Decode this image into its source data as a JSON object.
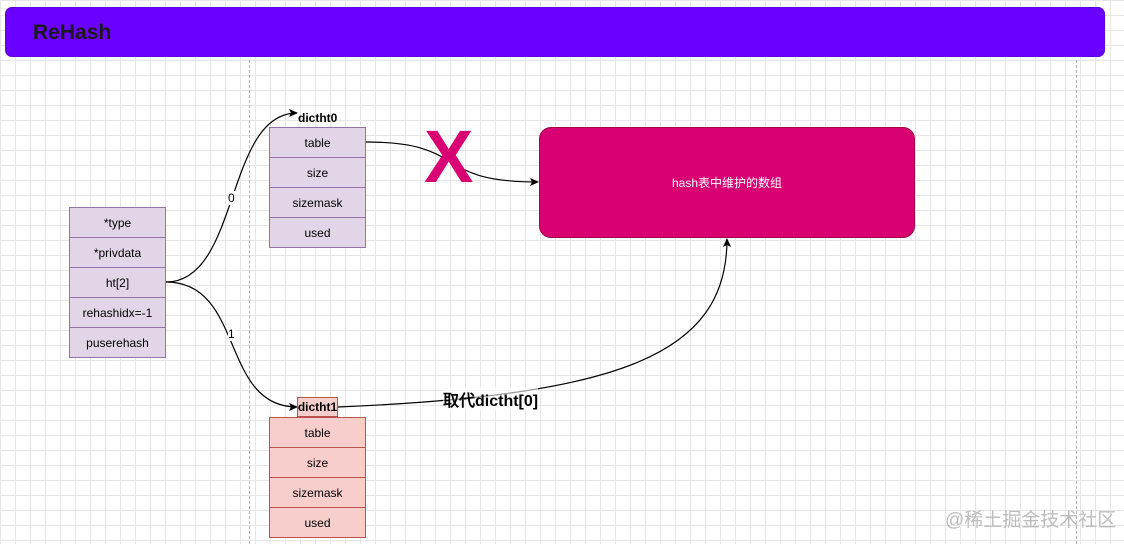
{
  "title": "ReHash",
  "dict": {
    "fields": [
      "*type",
      "*privdata",
      "ht[2]",
      "rehashidx=-1",
      "puserehash"
    ]
  },
  "dictht0": {
    "label": "dictht0",
    "fields": [
      "table",
      "size",
      "sizemask",
      "used"
    ]
  },
  "dictht1": {
    "label": "dictht1",
    "fields": [
      "table",
      "size",
      "sizemask",
      "used"
    ]
  },
  "array_box": {
    "label": "hash表中维护的数组"
  },
  "edges": {
    "to_ht0": "0",
    "to_ht1": "1",
    "replace": "取代dictht[0]"
  },
  "x_mark": "X",
  "watermark": "@稀土掘金技术社区",
  "colors": {
    "banner": "#6a00ff",
    "dict_fill": "#e1d5e7",
    "ht1_fill": "#f8cecc",
    "array_fill": "#d80073"
  }
}
